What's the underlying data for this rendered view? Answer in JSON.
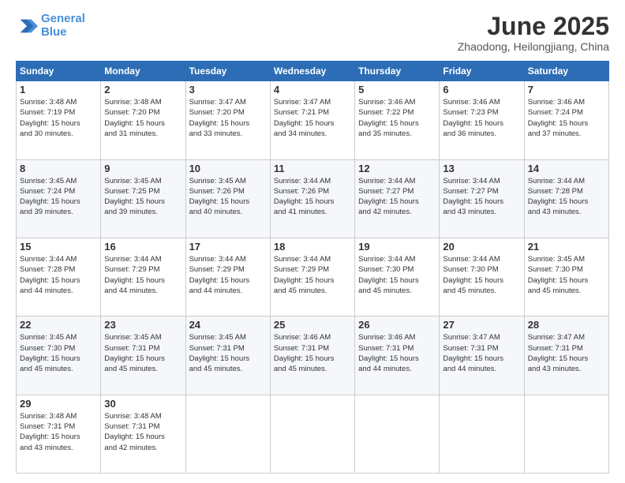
{
  "logo": {
    "line1": "General",
    "line2": "Blue"
  },
  "title": "June 2025",
  "subtitle": "Zhaodong, Heilongjiang, China",
  "weekdays": [
    "Sunday",
    "Monday",
    "Tuesday",
    "Wednesday",
    "Thursday",
    "Friday",
    "Saturday"
  ],
  "weeks": [
    [
      {
        "day": 1,
        "info": "Sunrise: 3:48 AM\nSunset: 7:19 PM\nDaylight: 15 hours\nand 30 minutes."
      },
      {
        "day": 2,
        "info": "Sunrise: 3:48 AM\nSunset: 7:20 PM\nDaylight: 15 hours\nand 31 minutes."
      },
      {
        "day": 3,
        "info": "Sunrise: 3:47 AM\nSunset: 7:20 PM\nDaylight: 15 hours\nand 33 minutes."
      },
      {
        "day": 4,
        "info": "Sunrise: 3:47 AM\nSunset: 7:21 PM\nDaylight: 15 hours\nand 34 minutes."
      },
      {
        "day": 5,
        "info": "Sunrise: 3:46 AM\nSunset: 7:22 PM\nDaylight: 15 hours\nand 35 minutes."
      },
      {
        "day": 6,
        "info": "Sunrise: 3:46 AM\nSunset: 7:23 PM\nDaylight: 15 hours\nand 36 minutes."
      },
      {
        "day": 7,
        "info": "Sunrise: 3:46 AM\nSunset: 7:24 PM\nDaylight: 15 hours\nand 37 minutes."
      }
    ],
    [
      {
        "day": 8,
        "info": "Sunrise: 3:45 AM\nSunset: 7:24 PM\nDaylight: 15 hours\nand 39 minutes."
      },
      {
        "day": 9,
        "info": "Sunrise: 3:45 AM\nSunset: 7:25 PM\nDaylight: 15 hours\nand 39 minutes."
      },
      {
        "day": 10,
        "info": "Sunrise: 3:45 AM\nSunset: 7:26 PM\nDaylight: 15 hours\nand 40 minutes."
      },
      {
        "day": 11,
        "info": "Sunrise: 3:44 AM\nSunset: 7:26 PM\nDaylight: 15 hours\nand 41 minutes."
      },
      {
        "day": 12,
        "info": "Sunrise: 3:44 AM\nSunset: 7:27 PM\nDaylight: 15 hours\nand 42 minutes."
      },
      {
        "day": 13,
        "info": "Sunrise: 3:44 AM\nSunset: 7:27 PM\nDaylight: 15 hours\nand 43 minutes."
      },
      {
        "day": 14,
        "info": "Sunrise: 3:44 AM\nSunset: 7:28 PM\nDaylight: 15 hours\nand 43 minutes."
      }
    ],
    [
      {
        "day": 15,
        "info": "Sunrise: 3:44 AM\nSunset: 7:28 PM\nDaylight: 15 hours\nand 44 minutes."
      },
      {
        "day": 16,
        "info": "Sunrise: 3:44 AM\nSunset: 7:29 PM\nDaylight: 15 hours\nand 44 minutes."
      },
      {
        "day": 17,
        "info": "Sunrise: 3:44 AM\nSunset: 7:29 PM\nDaylight: 15 hours\nand 44 minutes."
      },
      {
        "day": 18,
        "info": "Sunrise: 3:44 AM\nSunset: 7:29 PM\nDaylight: 15 hours\nand 45 minutes."
      },
      {
        "day": 19,
        "info": "Sunrise: 3:44 AM\nSunset: 7:30 PM\nDaylight: 15 hours\nand 45 minutes."
      },
      {
        "day": 20,
        "info": "Sunrise: 3:44 AM\nSunset: 7:30 PM\nDaylight: 15 hours\nand 45 minutes."
      },
      {
        "day": 21,
        "info": "Sunrise: 3:45 AM\nSunset: 7:30 PM\nDaylight: 15 hours\nand 45 minutes."
      }
    ],
    [
      {
        "day": 22,
        "info": "Sunrise: 3:45 AM\nSunset: 7:30 PM\nDaylight: 15 hours\nand 45 minutes."
      },
      {
        "day": 23,
        "info": "Sunrise: 3:45 AM\nSunset: 7:31 PM\nDaylight: 15 hours\nand 45 minutes."
      },
      {
        "day": 24,
        "info": "Sunrise: 3:45 AM\nSunset: 7:31 PM\nDaylight: 15 hours\nand 45 minutes."
      },
      {
        "day": 25,
        "info": "Sunrise: 3:46 AM\nSunset: 7:31 PM\nDaylight: 15 hours\nand 45 minutes."
      },
      {
        "day": 26,
        "info": "Sunrise: 3:46 AM\nSunset: 7:31 PM\nDaylight: 15 hours\nand 44 minutes."
      },
      {
        "day": 27,
        "info": "Sunrise: 3:47 AM\nSunset: 7:31 PM\nDaylight: 15 hours\nand 44 minutes."
      },
      {
        "day": 28,
        "info": "Sunrise: 3:47 AM\nSunset: 7:31 PM\nDaylight: 15 hours\nand 43 minutes."
      }
    ],
    [
      {
        "day": 29,
        "info": "Sunrise: 3:48 AM\nSunset: 7:31 PM\nDaylight: 15 hours\nand 43 minutes."
      },
      {
        "day": 30,
        "info": "Sunrise: 3:48 AM\nSunset: 7:31 PM\nDaylight: 15 hours\nand 42 minutes."
      },
      null,
      null,
      null,
      null,
      null
    ]
  ]
}
